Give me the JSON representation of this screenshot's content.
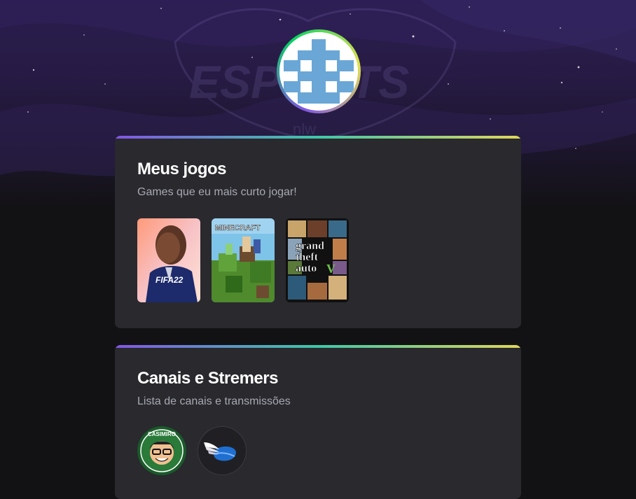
{
  "profile": {
    "avatar_icon": "pixel-avatar-icon",
    "ring_colors": [
      "#8257e5",
      "#04d361",
      "#e1e14d"
    ]
  },
  "background": {
    "watermark_icon": "esports-logo-icon",
    "watermark_text": "ESPORTS",
    "watermark_sub": "nlw"
  },
  "games_section": {
    "title": "Meus jogos",
    "subtitle": "Games que eu mais curto jogar!",
    "items": [
      {
        "icon": "fifa-22-cover-icon",
        "label": "FIFA22"
      },
      {
        "icon": "minecraft-cover-icon",
        "label": "MINECRAFT"
      },
      {
        "icon": "gta-v-cover-icon",
        "label": "grand theft auto"
      }
    ]
  },
  "channels_section": {
    "title": "Canais e Stremers",
    "subtitle": "Lista de canais e transmissões",
    "items": [
      {
        "icon": "casimiro-channel-icon",
        "label": "CASIMIRO"
      },
      {
        "icon": "winged-helmet-channel-icon"
      }
    ]
  },
  "colors": {
    "background": "#121214",
    "card": "#29292e",
    "accent_gradient": [
      "#8257e5",
      "#3fc7a8",
      "#e1d65a"
    ]
  }
}
